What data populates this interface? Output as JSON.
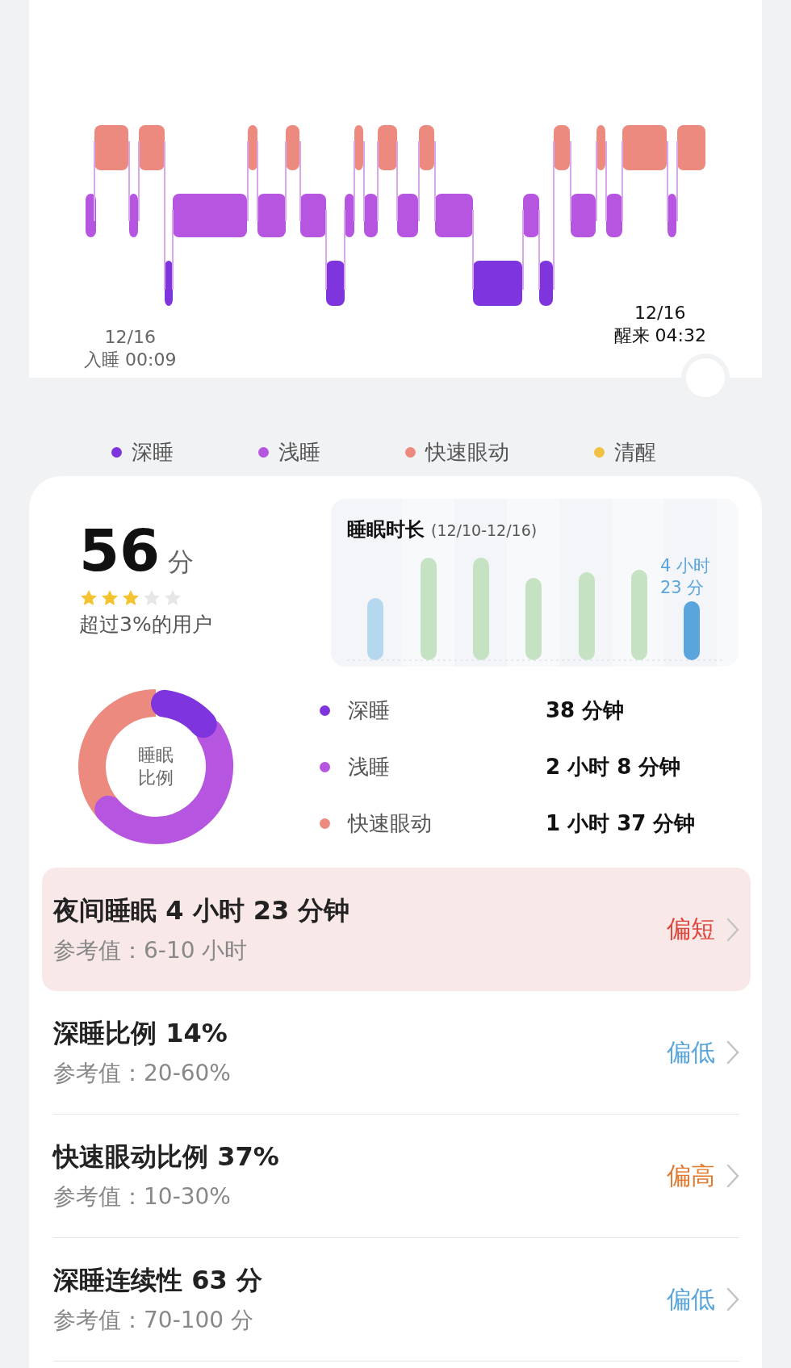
{
  "sleep_chart": {
    "start_date": "12/16",
    "start_label": "入睡 00:09",
    "end_date": "12/16",
    "end_label": "醒来 04:32"
  },
  "legend": [
    {
      "label": "深睡",
      "color": "#7f35dd"
    },
    {
      "label": "浅睡",
      "color": "#b655e0"
    },
    {
      "label": "快速眼动",
      "color": "#ec8a80"
    },
    {
      "label": "清醒",
      "color": "#f2c144"
    }
  ],
  "score": {
    "value": "56",
    "unit": "分",
    "stars": 3,
    "caption": "超过3%的用户"
  },
  "duration_chart": {
    "title": "睡眠时长",
    "range": "(12/10-12/16)",
    "latest_line1": "4 小时",
    "latest_line2": "23 分"
  },
  "ratio": {
    "center_line1": "睡眠",
    "center_line2": "比例",
    "stages": [
      {
        "name": "深睡",
        "value": "38 分钟",
        "color": "#7f35dd"
      },
      {
        "name": "浅睡",
        "value": "2 小时 8 分钟",
        "color": "#b655e0"
      },
      {
        "name": "快速眼动",
        "value": "1 小时 37 分钟",
        "color": "#ec8a80"
      }
    ]
  },
  "findings": [
    {
      "title": "夜间睡眠 4 小时 23 分钟",
      "reference": "参考值：6-10 小时",
      "status": "偏短",
      "color": "#e0463c",
      "highlighted": true
    },
    {
      "title": "深睡比例 14%",
      "reference": "参考值：20-60%",
      "status": "偏低",
      "color": "#5aa6dc",
      "highlighted": false
    },
    {
      "title": "快速眼动比例 37%",
      "reference": "参考值：10-30%",
      "status": "偏高",
      "color": "#e07a30",
      "highlighted": false
    },
    {
      "title": "深睡连续性 63 分",
      "reference": "参考值：70-100 分",
      "status": "偏低",
      "color": "#5aa6dc",
      "highlighted": false
    }
  ]
}
